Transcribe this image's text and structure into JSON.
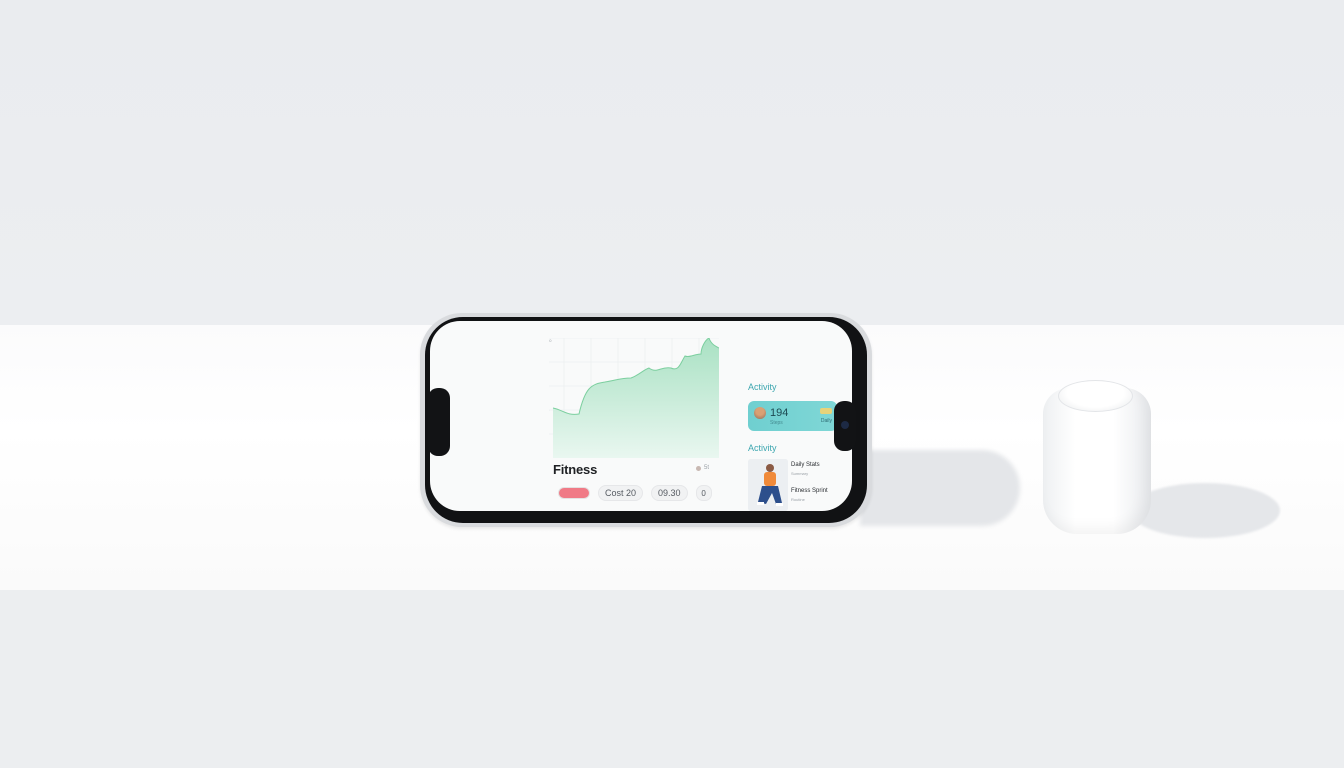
{
  "screen": {
    "title": "Fitness",
    "meta_text": "5t",
    "buttons": {
      "primary_label": "",
      "chip_1": "Cost 20",
      "chip_2": "09.30",
      "chip_3": "0"
    },
    "chart": {
      "y_tick_labels": [
        "10",
        "5",
        "3",
        "0"
      ],
      "fill_color": "#bfe8d3",
      "line_color": "#7ccf9f"
    },
    "activity_section": {
      "label": "Activity",
      "card_value": "194",
      "card_sub": "Steps",
      "card_badge": "Daily"
    },
    "workout_section": {
      "label": "Activity",
      "items": [
        {
          "title": "Daily Stats",
          "sub": "Summary"
        },
        {
          "title": "Fitness Sprint",
          "sub": "Routine"
        }
      ]
    },
    "accent_color": "#3ea7b0",
    "card_color": "#72d1d1",
    "primary_pill_color": "#f07a86"
  }
}
